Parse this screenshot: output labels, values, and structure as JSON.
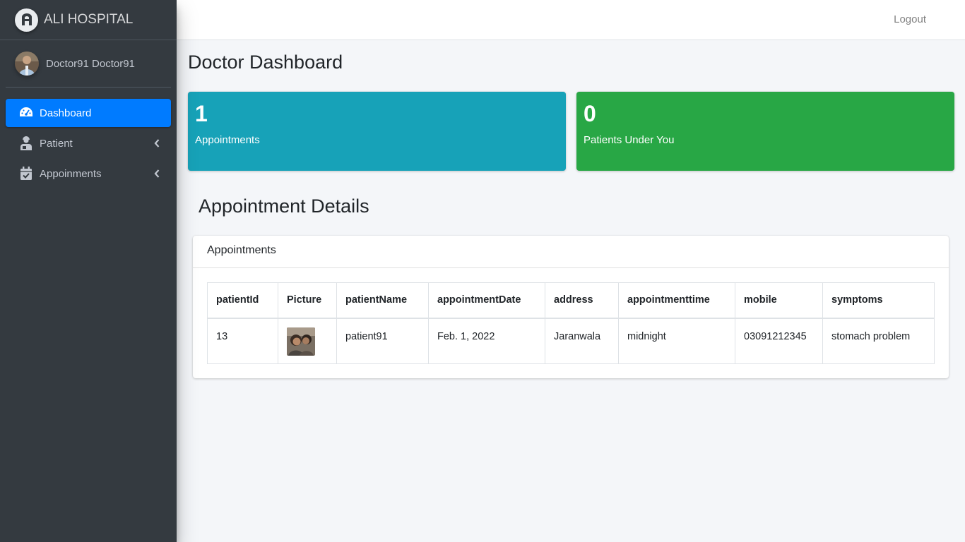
{
  "brand": {
    "name": "ALI HOSPITAL",
    "logo_icon": "hospital-logo-icon"
  },
  "user": {
    "name": "Doctor91 Doctor91"
  },
  "sidebar": {
    "items": [
      {
        "label": "Dashboard",
        "icon": "tachometer-icon",
        "active": true
      },
      {
        "label": "Patient",
        "icon": "user-injured-icon",
        "has_submenu": true
      },
      {
        "label": "Appoinments",
        "icon": "calendar-check-icon",
        "has_submenu": true
      }
    ]
  },
  "topbar": {
    "logout_label": "Logout"
  },
  "page": {
    "title": "Doctor Dashboard"
  },
  "stats": [
    {
      "value": "1",
      "label": "Appointments",
      "color": "#17a2b8"
    },
    {
      "value": "0",
      "label": "Patients Under You",
      "color": "#28a745"
    }
  ],
  "section": {
    "title": "Appointment Details"
  },
  "card": {
    "title": "Appointments",
    "columns": [
      "patientId",
      "Picture",
      "patientName",
      "appointmentDate",
      "address",
      "appointmenttime",
      "mobile",
      "symptoms"
    ],
    "rows": [
      {
        "patientId": "13",
        "patientName": "patient91",
        "appointmentDate": "Feb. 1, 2022",
        "address": "Jaranwala",
        "appointmenttime": "midnight",
        "mobile": "03091212345",
        "symptoms": "stomach problem"
      }
    ]
  },
  "colors": {
    "sidebar_bg": "#343a40",
    "active_nav": "#007bff",
    "content_bg": "#f4f6f9"
  }
}
